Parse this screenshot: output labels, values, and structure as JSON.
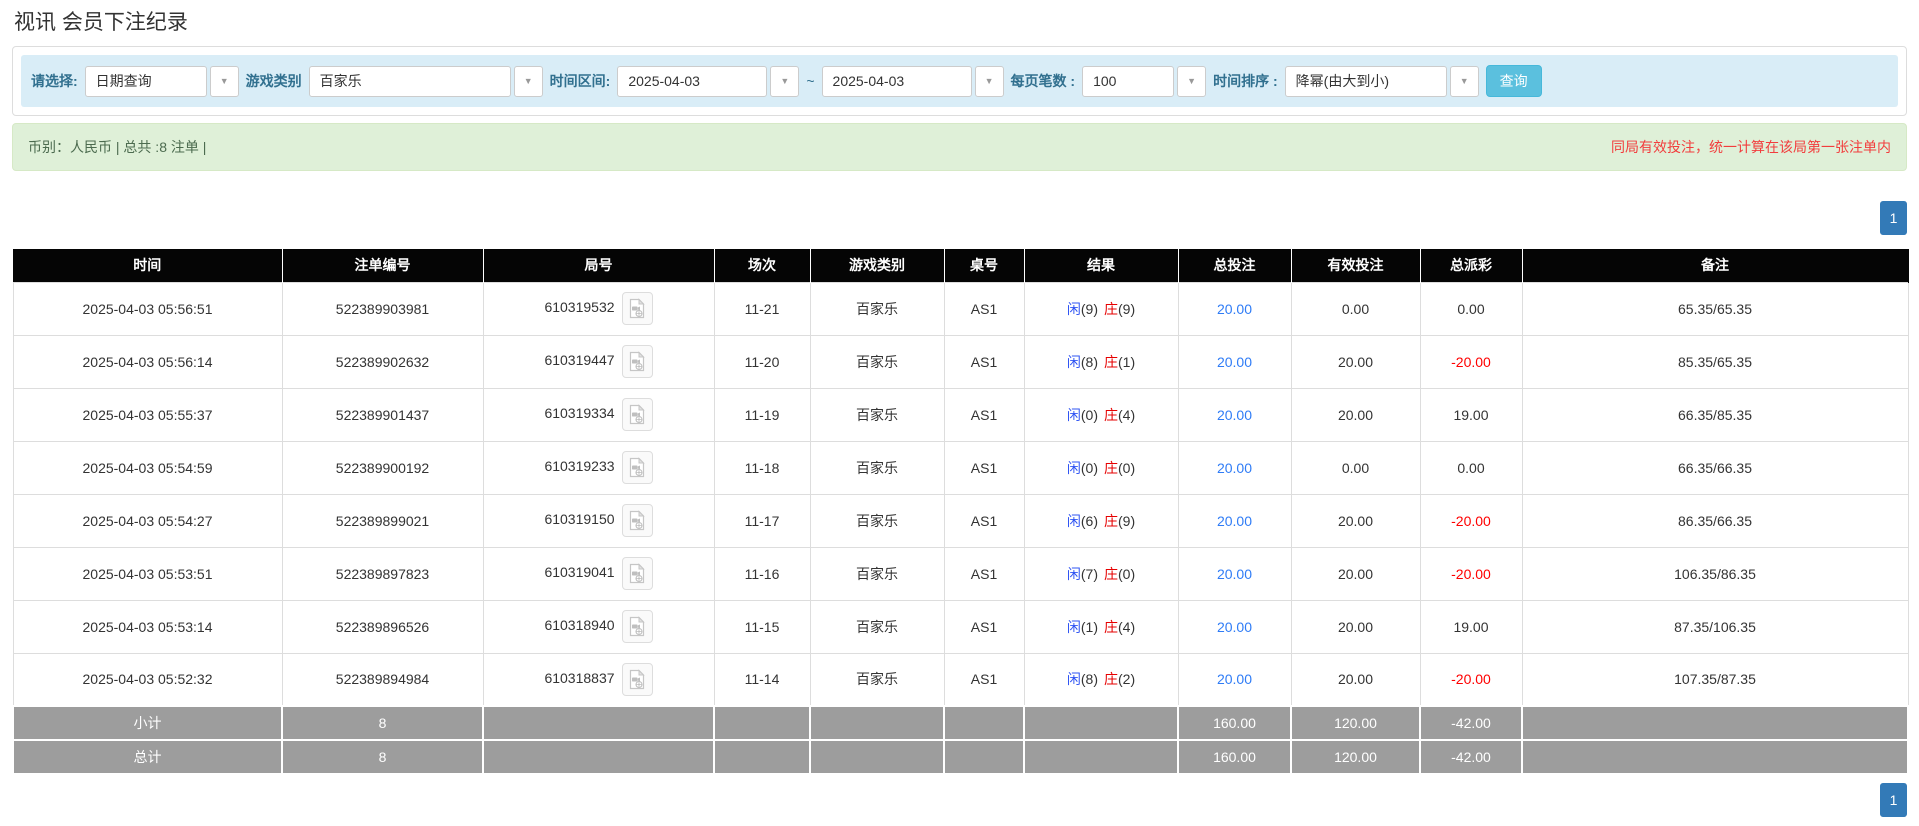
{
  "page_title": "视讯 会员下注纪录",
  "filter_bar": {
    "select_type": {
      "label": "请选择:",
      "value": "日期查询"
    },
    "game_category": {
      "label": "游戏类别",
      "value": "百家乐"
    },
    "time_range": {
      "label": "时间区间:",
      "from": "2025-04-03",
      "separator": "~",
      "to": "2025-04-03"
    },
    "page_size": {
      "label": "每页笔数 :",
      "value": "100"
    },
    "time_sort": {
      "label": "时间排序 :",
      "value": "降幂(由大到小)"
    },
    "search_button": "查询"
  },
  "info_bar": {
    "left_text": "币别：人民币 | 总共 :8 注单 |",
    "right_text": "同局有效投注，统一计算在该局第一张注单内"
  },
  "pagination": {
    "top": "1",
    "bottom": "1"
  },
  "icons": {
    "dropdown_arrow": "▼",
    "round_video_icon": "video-record-icon"
  },
  "colors": {
    "accent_button": "#5bc0de",
    "pagination_active": "#337ab7",
    "filter_bar_bg": "#d9edf7",
    "info_bar_bg": "#dff0d8",
    "warning_red": "#f23d3d",
    "link_blue": "#2f7cf6",
    "player_blue": "#2f54f3",
    "banker_red": "#e60000",
    "negative_red": "#ff0000",
    "header_bg": "#050505",
    "summary_bg": "#9d9d9d"
  },
  "table": {
    "columns": [
      "时间",
      "注单编号",
      "局号",
      "场次",
      "游戏类别",
      "桌号",
      "结果",
      "总投注",
      "有效投注",
      "总派彩",
      "备注"
    ],
    "rows": [
      {
        "time": "2025-04-03 05:56:51",
        "bet_no": "522389903981",
        "round_no": "610319532",
        "session": "11-21",
        "game": "百家乐",
        "table_no": "AS1",
        "result": {
          "player_label": "闲",
          "player_value": "(9)",
          "banker_label": "庄",
          "banker_value": "(9)"
        },
        "total_bet": "20.00",
        "valid_bet": "0.00",
        "payout": "0.00",
        "remark": "65.35/65.35"
      },
      {
        "time": "2025-04-03 05:56:14",
        "bet_no": "522389902632",
        "round_no": "610319447",
        "session": "11-20",
        "game": "百家乐",
        "table_no": "AS1",
        "result": {
          "player_label": "闲",
          "player_value": "(8)",
          "banker_label": "庄",
          "banker_value": "(1)"
        },
        "total_bet": "20.00",
        "valid_bet": "20.00",
        "payout": "-20.00",
        "remark": "85.35/65.35"
      },
      {
        "time": "2025-04-03 05:55:37",
        "bet_no": "522389901437",
        "round_no": "610319334",
        "session": "11-19",
        "game": "百家乐",
        "table_no": "AS1",
        "result": {
          "player_label": "闲",
          "player_value": "(0)",
          "banker_label": "庄",
          "banker_value": "(4)"
        },
        "total_bet": "20.00",
        "valid_bet": "20.00",
        "payout": "19.00",
        "remark": "66.35/85.35"
      },
      {
        "time": "2025-04-03 05:54:59",
        "bet_no": "522389900192",
        "round_no": "610319233",
        "session": "11-18",
        "game": "百家乐",
        "table_no": "AS1",
        "result": {
          "player_label": "闲",
          "player_value": "(0)",
          "banker_label": "庄",
          "banker_value": "(0)"
        },
        "total_bet": "20.00",
        "valid_bet": "0.00",
        "payout": "0.00",
        "remark": "66.35/66.35"
      },
      {
        "time": "2025-04-03 05:54:27",
        "bet_no": "522389899021",
        "round_no": "610319150",
        "session": "11-17",
        "game": "百家乐",
        "table_no": "AS1",
        "result": {
          "player_label": "闲",
          "player_value": "(6)",
          "banker_label": "庄",
          "banker_value": "(9)"
        },
        "total_bet": "20.00",
        "valid_bet": "20.00",
        "payout": "-20.00",
        "remark": "86.35/66.35"
      },
      {
        "time": "2025-04-03 05:53:51",
        "bet_no": "522389897823",
        "round_no": "610319041",
        "session": "11-16",
        "game": "百家乐",
        "table_no": "AS1",
        "result": {
          "player_label": "闲",
          "player_value": "(7)",
          "banker_label": "庄",
          "banker_value": "(0)"
        },
        "total_bet": "20.00",
        "valid_bet": "20.00",
        "payout": "-20.00",
        "remark": "106.35/86.35"
      },
      {
        "time": "2025-04-03 05:53:14",
        "bet_no": "522389896526",
        "round_no": "610318940",
        "session": "11-15",
        "game": "百家乐",
        "table_no": "AS1",
        "result": {
          "player_label": "闲",
          "player_value": "(1)",
          "banker_label": "庄",
          "banker_value": "(4)"
        },
        "total_bet": "20.00",
        "valid_bet": "20.00",
        "payout": "19.00",
        "remark": "87.35/106.35"
      },
      {
        "time": "2025-04-03 05:52:32",
        "bet_no": "522389894984",
        "round_no": "610318837",
        "session": "11-14",
        "game": "百家乐",
        "table_no": "AS1",
        "result": {
          "player_label": "闲",
          "player_value": "(8)",
          "banker_label": "庄",
          "banker_value": "(2)"
        },
        "total_bet": "20.00",
        "valid_bet": "20.00",
        "payout": "-20.00",
        "remark": "107.35/87.35"
      }
    ],
    "summary_rows": [
      {
        "label": "小计",
        "count": "8",
        "total_bet": "160.00",
        "valid_bet": "120.00",
        "payout": "-42.00"
      },
      {
        "label": "总计",
        "count": "8",
        "total_bet": "160.00",
        "valid_bet": "120.00",
        "payout": "-42.00"
      }
    ]
  }
}
